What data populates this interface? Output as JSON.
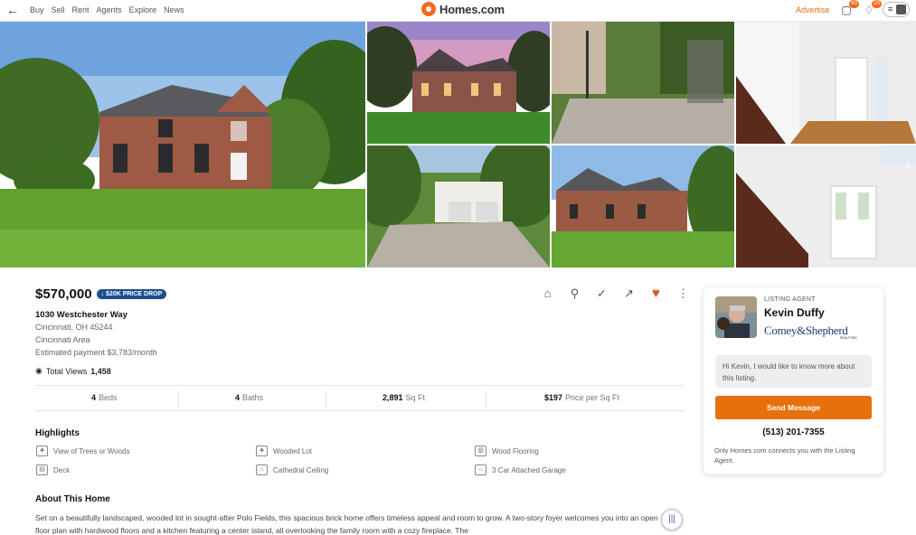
{
  "header": {
    "nav": [
      "Buy",
      "Sell",
      "Rent",
      "Agents",
      "Explore",
      "News"
    ],
    "logo_text": "Homes.com",
    "advertise": "Advertise",
    "messages_badge": "40",
    "notifications_badge": "20"
  },
  "listing": {
    "price": "$570,000",
    "price_drop": "$20K PRICE DROP",
    "address": "1030 Westchester Way",
    "city": "Cincinnati, OH 45244",
    "area": "Cincinnati Area",
    "estimated_payment": "Estimated payment $3,783/month",
    "total_views_label": "Total Views",
    "total_views": "1,458"
  },
  "stats": [
    {
      "value": "4",
      "label": "Beds"
    },
    {
      "value": "4",
      "label": "Baths"
    },
    {
      "value": "2,891",
      "label": "Sq Ft"
    },
    {
      "value": "$197",
      "label": "Price per Sq Ft"
    }
  ],
  "highlights": {
    "title": "Highlights",
    "items": [
      "View of Trees or Woods",
      "Wooded Lot",
      "Wood Flooring",
      "Deck",
      "Cathedral Ceiling",
      "3 Car Attached Garage"
    ]
  },
  "about": {
    "title": "About This Home",
    "text": "Set on a beautifully landscaped, wooded lot in sought-after Polo Fields, this spacious brick home offers timeless appeal and room to grow. A two-story foyer welcomes you into an open floor plan with hardwood floors and a kitchen featuring a center island, all overlooking the family room with a cozy fireplace. The"
  },
  "agent": {
    "label": "LISTING AGENT",
    "name": "Kevin Duffy",
    "brokerage": "Comey&Shepherd",
    "brokerage_sub": "REALTORS",
    "message": "Hi Kevin, I would like to know more about this listing.",
    "send_label": "Send Message",
    "phone": "(513) 201-7355",
    "note": "Only Homes.com connects you with the Listing Agent."
  },
  "colors": {
    "accent": "#e7700d",
    "price_drop_badge": "#1d4e8f",
    "favorite": "#e0521b"
  }
}
